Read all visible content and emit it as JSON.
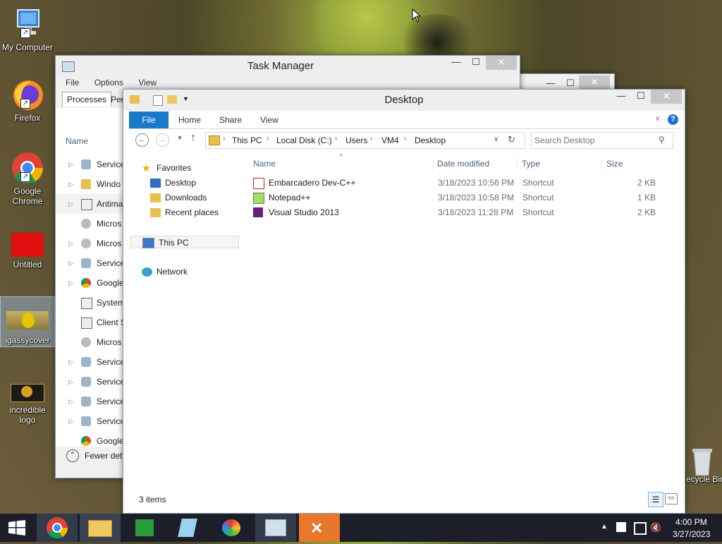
{
  "desktop_icons": [
    {
      "label": "My Computer"
    },
    {
      "label": "Firefox"
    },
    {
      "label": "Google Chrome"
    },
    {
      "label": "Untitled"
    },
    {
      "label": "igassycover"
    },
    {
      "label": "incredible logo"
    },
    {
      "label": "Recycle Bin"
    }
  ],
  "task_manager": {
    "title": "Task Manager",
    "menu": [
      "File",
      "Options",
      "View"
    ],
    "tabs": [
      "Processes",
      "Per"
    ],
    "column_name": "Name",
    "rows": [
      "Service",
      "Windo",
      "Antima",
      "Micros",
      "Micros",
      "Service",
      "Google",
      "System",
      "Client S",
      "Micros",
      "Service",
      "Service",
      "Service",
      "Service",
      "Google"
    ],
    "fewer_details": "Fewer deta"
  },
  "explorer": {
    "title": "Desktop",
    "ribbon_tabs": [
      "File",
      "Home",
      "Share",
      "View"
    ],
    "breadcrumb": [
      "This PC",
      "Local Disk (C:)",
      "Users",
      "VM4",
      "Desktop"
    ],
    "search_placeholder": "Search Desktop",
    "nav": {
      "favorites": "Favorites",
      "desktop": "Desktop",
      "downloads": "Downloads",
      "recent": "Recent places",
      "this_pc": "This PC",
      "network": "Network"
    },
    "columns": {
      "name": "Name",
      "date": "Date modified",
      "type": "Type",
      "size": "Size"
    },
    "files": [
      {
        "name": "Embarcadero Dev-C++",
        "date": "3/18/2023 10:56 PM",
        "type": "Shortcut",
        "size": "2 KB"
      },
      {
        "name": "Notepad++",
        "date": "3/18/2023 10:58 PM",
        "type": "Shortcut",
        "size": "1 KB"
      },
      {
        "name": "Visual Studio 2013",
        "date": "3/18/2023 11:28 PM",
        "type": "Shortcut",
        "size": "2 KB"
      }
    ],
    "status": "3 items"
  },
  "taskbar": {
    "time": "4:00 PM",
    "date": "3/27/2023"
  }
}
